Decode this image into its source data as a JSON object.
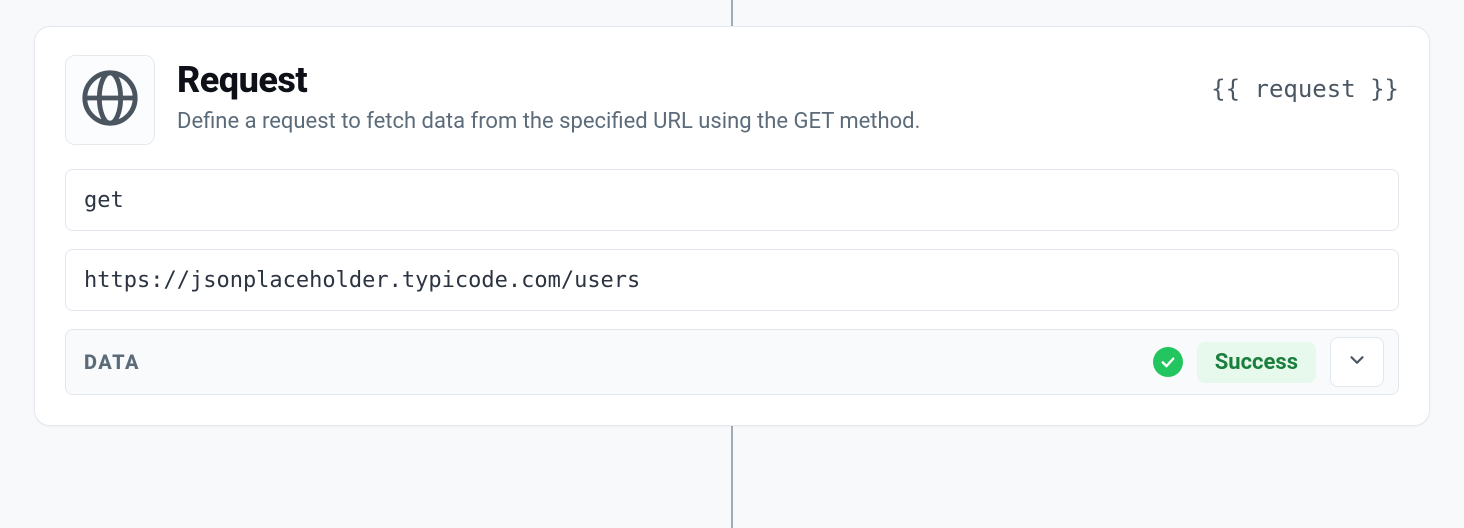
{
  "card": {
    "title": "Request",
    "subtitle": "Define a request to fetch data from the specified URL using the GET method.",
    "variable_tag": "{{ request }}",
    "method_input": "get",
    "url_input": "https://jsonplaceholder.typicode.com/users",
    "result": {
      "label": "DATA",
      "status": "Success"
    }
  }
}
